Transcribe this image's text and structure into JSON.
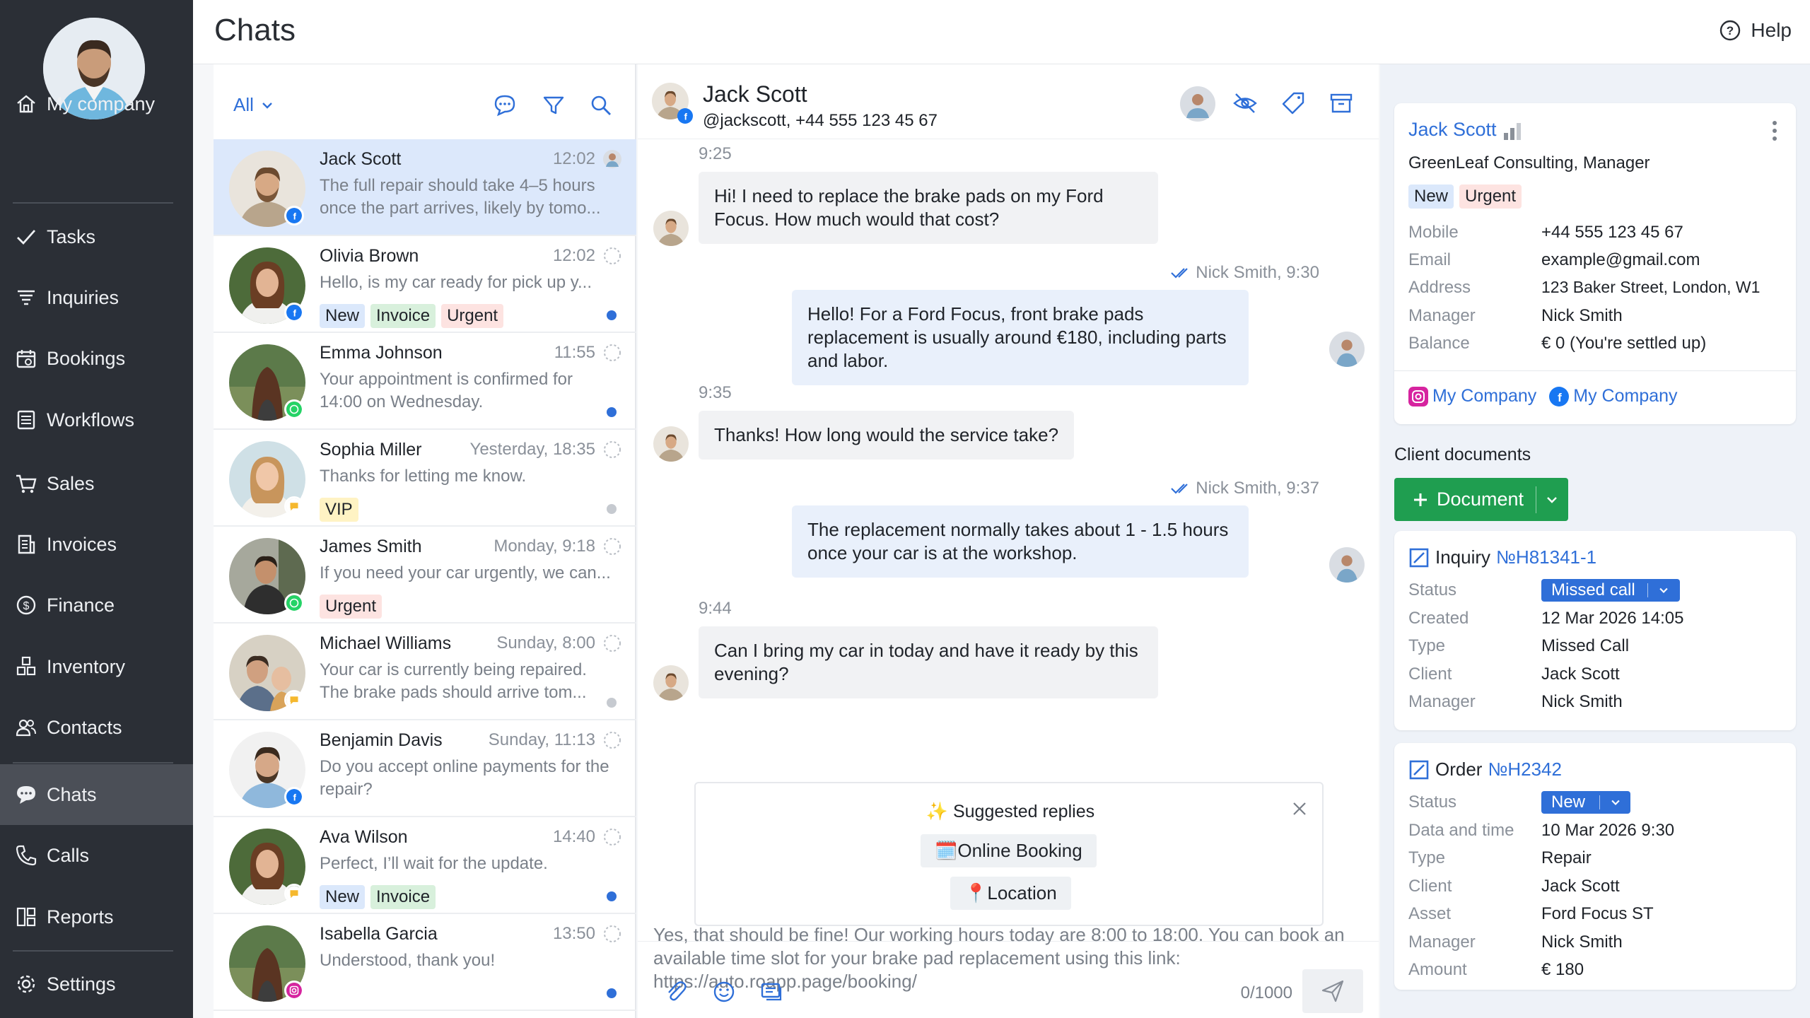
{
  "header": {
    "title": "Chats",
    "help_label": "Help"
  },
  "sidebar": {
    "items": [
      {
        "label": "My company",
        "icon": "home-icon"
      },
      {
        "label": "Tasks",
        "icon": "check-icon"
      },
      {
        "label": "Inquiries",
        "icon": "funnel-icon"
      },
      {
        "label": "Bookings",
        "icon": "calendar-icon"
      },
      {
        "label": "Workflows",
        "icon": "document-icon"
      },
      {
        "label": "Sales",
        "icon": "cart-icon"
      },
      {
        "label": "Invoices",
        "icon": "invoice-icon"
      },
      {
        "label": "Finance",
        "icon": "dollar-icon"
      },
      {
        "label": "Inventory",
        "icon": "boxes-icon"
      },
      {
        "label": "Contacts",
        "icon": "people-icon"
      },
      {
        "label": "Chats",
        "icon": "chat-bubble-icon"
      },
      {
        "label": "Calls",
        "icon": "phone-icon"
      },
      {
        "label": "Reports",
        "icon": "grid-icon"
      },
      {
        "label": "Settings",
        "icon": "gear-icon"
      }
    ]
  },
  "chat_list": {
    "filter_label": "All",
    "chats": [
      {
        "name": "Jack Scott",
        "time": "12:02",
        "preview": "The full repair should take 4–5 hours once the part arrives, likely by tomo...",
        "channel": "facebook",
        "tags": []
      },
      {
        "name": "Olivia Brown",
        "time": "12:02",
        "preview": "Hello, is my car ready for pick up y...",
        "channel": "facebook",
        "tags": [
          "New",
          "Invoice",
          "Urgent"
        ]
      },
      {
        "name": "Emma Johnson",
        "time": "11:55",
        "preview": "Your appointment is confirmed for 14:00 on Wednesday.",
        "channel": "whatsapp",
        "tags": []
      },
      {
        "name": "Sophia Miller",
        "time": "Yesterday, 18:35",
        "preview": "Thanks for letting me know.",
        "channel": "chat",
        "tags": [
          "VIP"
        ]
      },
      {
        "name": "James Smith",
        "time": "Monday, 9:18",
        "preview": "If you need your car urgently, we can...",
        "channel": "whatsapp",
        "tags": [
          "Urgent"
        ]
      },
      {
        "name": "Michael Williams",
        "time": "Sunday, 8:00",
        "preview": "Your car is currently being repaired. The brake pads should arrive tom...",
        "channel": "chat",
        "tags": []
      },
      {
        "name": "Benjamin Davis",
        "time": "Sunday, 11:13",
        "preview": "Do you accept online payments for the repair?",
        "channel": "facebook",
        "tags": []
      },
      {
        "name": "Ava Wilson",
        "time": "14:40",
        "preview": "Perfect, I’ll wait for the update.",
        "channel": "chat",
        "tags": [
          "New",
          "Invoice"
        ]
      },
      {
        "name": "Isabella Garcia",
        "time": "13:50",
        "preview": "Understood, thank you!",
        "channel": "instagram",
        "tags": []
      }
    ]
  },
  "conversation": {
    "name": "Jack Scott",
    "handle": "@jackscott, +44 555 123 45 67",
    "messages": [
      {
        "direction": "in",
        "time": "9:25",
        "text": "Hi! I need to replace the brake pads on my Ford Focus. How much would that cost?"
      },
      {
        "direction": "out",
        "meta": "Nick Smith, 9:30",
        "text": "Hello! For a Ford Focus, front brake pads replacement is usually around €180, including parts and labor."
      },
      {
        "direction": "in",
        "time": "9:35",
        "text": "Thanks! How long would the service take?"
      },
      {
        "direction": "out",
        "meta": "Nick Smith, 9:37",
        "text": "The replacement normally takes about 1 - 1.5 hours once your car is at the workshop."
      },
      {
        "direction": "in",
        "time": "9:44",
        "text": "Can I bring my car in today and have it ready by this evening?"
      }
    ],
    "suggested": {
      "title": "Suggested replies",
      "items": [
        "Online Booking",
        "Location"
      ]
    },
    "composer": {
      "text": "Yes, that should be fine! Our working hours today are 8:00 to 18:00. You can book an available time slot for your brake pad replacement using this link: https://auto.roapp.page/booking/",
      "counter": "0/1000"
    }
  },
  "client": {
    "name": "Jack Scott",
    "company": "GreenLeaf Consulting, Manager",
    "tags": [
      "New",
      "Urgent"
    ],
    "fields": [
      {
        "label": "Mobile",
        "value": "+44 555 123 45 67"
      },
      {
        "label": "Email",
        "value": "example@gmail.com"
      },
      {
        "label": "Address",
        "value": "123 Baker Street, London, W1"
      },
      {
        "label": "Manager",
        "value": "Nick Smith"
      },
      {
        "label": "Balance",
        "value": "€ 0 (You're settled up)"
      }
    ],
    "links": [
      "My Company",
      "My Company"
    ]
  },
  "documents": {
    "label": "Client documents",
    "add_button": "Document",
    "inquiry": {
      "title": "Inquiry",
      "number": "№H81341-1",
      "status": "Missed call",
      "fields": [
        {
          "label": "Status",
          "value": ""
        },
        {
          "label": "Created",
          "value": "12 Mar 2026 14:05"
        },
        {
          "label": "Type",
          "value": "Missed Call"
        },
        {
          "label": "Client",
          "value": "Jack Scott"
        },
        {
          "label": "Manager",
          "value": "Nick Smith"
        }
      ]
    },
    "order": {
      "title": "Order",
      "number": "№H2342",
      "status": "New",
      "fields": [
        {
          "label": "Status",
          "value": ""
        },
        {
          "label": "Data and time",
          "value": "10 Mar 2026 9:30"
        },
        {
          "label": "Type",
          "value": "Repair"
        },
        {
          "label": "Client",
          "value": "Jack Scott"
        },
        {
          "label": "Asset",
          "value": "Ford Focus ST"
        },
        {
          "label": "Manager",
          "value": "Nick Smith"
        },
        {
          "label": "Amount",
          "value": "€ 180"
        }
      ]
    }
  },
  "colors": {
    "sidebar": "#2b2f36",
    "accent": "#2f6fd8",
    "green": "#1f9e50",
    "selected_row": "#dce8fb"
  }
}
